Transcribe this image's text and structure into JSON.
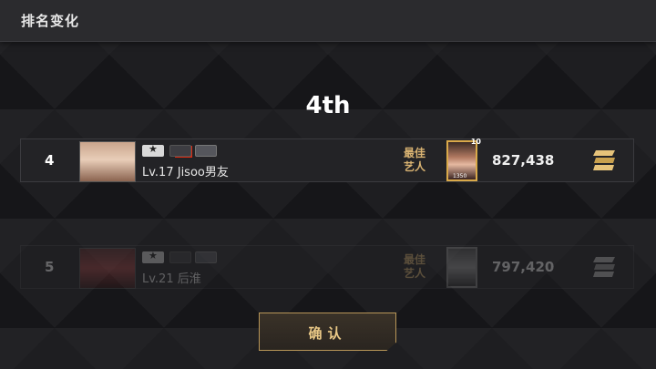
{
  "header": {
    "title": "排名变化"
  },
  "rank_title": "4th",
  "rows": [
    {
      "rank": "4",
      "flag": "★",
      "player_name": "Lv.17 Jisoo男友",
      "best_label_line1": "最佳",
      "best_label_line2": "艺人",
      "card_level": "10",
      "card_value": "1350",
      "score": "827,438",
      "grade_icon": "s-grade-icon"
    },
    {
      "rank": "5",
      "flag": "",
      "player_name": "Lv.21 后淮",
      "best_label_line1": "最佳",
      "best_label_line2": "艺人",
      "card_level": "",
      "card_value": "",
      "score": "797,420",
      "grade_icon": "s-grade-icon"
    }
  ],
  "confirm_button": {
    "label": "确认"
  },
  "colors": {
    "gold": "#d9b372",
    "accent_border": "#b89658"
  }
}
